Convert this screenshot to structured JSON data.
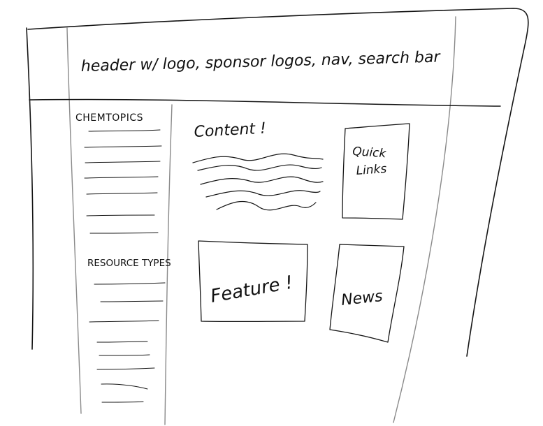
{
  "header": {
    "text": "header w/ logo, sponsor logos, nav, search bar"
  },
  "sidebar": {
    "section1_title": "CHEMTOPICS",
    "section2_title": "RESOURCE TYPES"
  },
  "content": {
    "label": "Content !"
  },
  "quick_links": {
    "line1": "Quick",
    "line2": "Links"
  },
  "feature": {
    "label": "Feature !"
  },
  "news": {
    "label": "News"
  }
}
